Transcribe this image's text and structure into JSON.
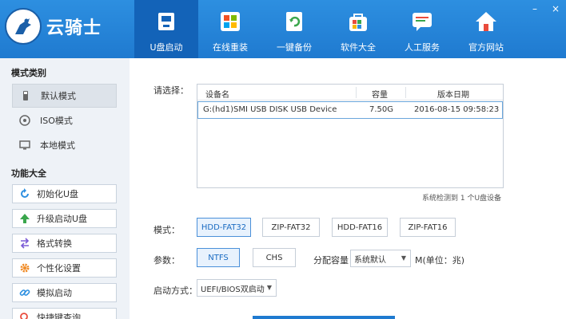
{
  "app": {
    "logo_text": "云骑士",
    "window_controls": [
      "–",
      "×"
    ]
  },
  "nav": [
    {
      "label": "U盘启动",
      "icon": "usb-disk-icon",
      "active": true
    },
    {
      "label": "在线重装",
      "icon": "windows-icon",
      "active": false
    },
    {
      "label": "一键备份",
      "icon": "backup-icon",
      "active": false
    },
    {
      "label": "软件大全",
      "icon": "software-bag-icon",
      "active": false
    },
    {
      "label": "人工服务",
      "icon": "chat-service-icon",
      "active": false
    },
    {
      "label": "官方网站",
      "icon": "home-icon",
      "active": false
    }
  ],
  "sidebar": {
    "mode_title": "模式类别",
    "modes": [
      {
        "label": "默认模式",
        "icon": "usb-stick-icon",
        "active": true
      },
      {
        "label": "ISO模式",
        "icon": "disc-icon",
        "active": false
      },
      {
        "label": "本地模式",
        "icon": "monitor-icon",
        "active": false
      }
    ],
    "func_title": "功能大全",
    "functions": [
      {
        "label": "初始化U盘",
        "icon": "refresh-icon"
      },
      {
        "label": "升级启动U盘",
        "icon": "up-arrow-icon"
      },
      {
        "label": "格式转换",
        "icon": "convert-icon"
      },
      {
        "label": "个性化设置",
        "icon": "gear-icon"
      },
      {
        "label": "模拟启动",
        "icon": "link-icon"
      },
      {
        "label": "快捷键查询",
        "icon": "search-icon"
      }
    ]
  },
  "main": {
    "select_label": "请选择：",
    "table": {
      "headers": [
        "设备名",
        "容量",
        "版本日期"
      ],
      "rows": [
        {
          "device": "G:(hd1)SMI USB DISK USB Device",
          "capacity": "7.50G",
          "date": "2016-08-15 09:58:23"
        }
      ]
    },
    "detect_text": "系统检测到 1 个U盘设备",
    "mode_label": "模式：",
    "modes": [
      {
        "label": "HDD-FAT32",
        "selected": true
      },
      {
        "label": "ZIP-FAT32",
        "selected": false
      },
      {
        "label": "HDD-FAT16",
        "selected": false
      },
      {
        "label": "ZIP-FAT16",
        "selected": false
      }
    ],
    "param_label": "参数：",
    "params": [
      {
        "label": "NTFS",
        "selected": true
      },
      {
        "label": "CHS",
        "selected": false
      }
    ],
    "alloc_label": "分配容量：",
    "alloc_value": "系统默认",
    "alloc_unit": "M(单位：兆)",
    "boot_label": "启动方式：",
    "boot_value": "UEFI/BIOS双启动"
  },
  "colors": {
    "header_blue": "#1f7ad0",
    "active_nav": "#1363b8",
    "selection_blue": "#4a90d9"
  }
}
